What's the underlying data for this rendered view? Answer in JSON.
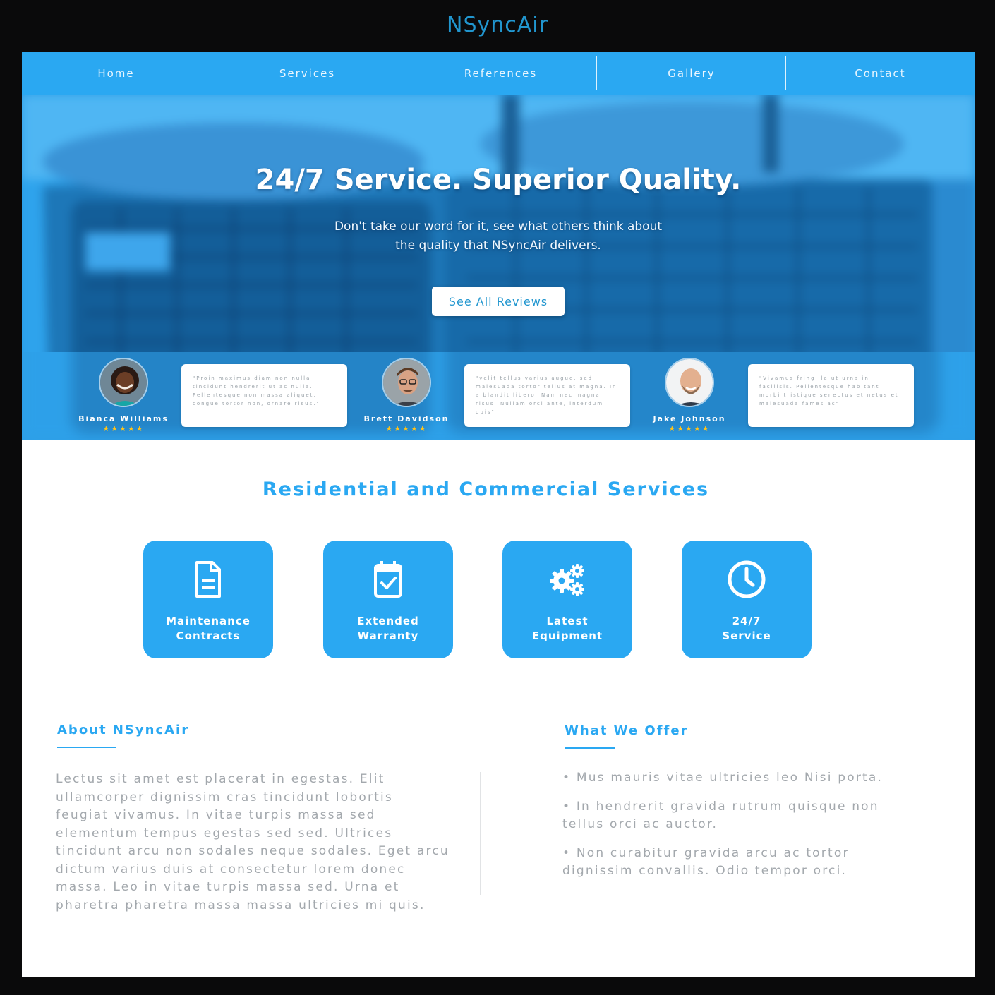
{
  "site": {
    "title": "NSyncAir"
  },
  "colors": {
    "accent": "#2aa8f2",
    "dark_bg": "#0a0a0b",
    "star": "#ffc21a",
    "body_text": "#a3a8ad"
  },
  "nav": {
    "items": [
      {
        "label": "Home"
      },
      {
        "label": "Services"
      },
      {
        "label": "References"
      },
      {
        "label": "Gallery"
      },
      {
        "label": "Contact"
      }
    ]
  },
  "hero": {
    "title": "24/7 Service. Superior Quality.",
    "subtitle": "Don't take our word for it, see what others think about the quality that NSyncAir delivers.",
    "button_label": "See All Reviews"
  },
  "reviews": [
    {
      "name": "Bianca Williams",
      "stars": "★★★★★",
      "rating": 5,
      "quote": "\"Proin maximus diam non nulla tincidunt hendrerit ut ac nulla. Pellentesque non massa aliquet, congue tortor non, ornare risus.\""
    },
    {
      "name": "Brett Davidson",
      "stars": "★★★★★",
      "rating": 5,
      "quote": "\"velit tellus varius augue, sed malesuada tortor tellus at magna. In a blandit libero. Nam nec magna risus. Nullam orci ante, interdum quis\""
    },
    {
      "name": "Jake Johnson",
      "stars": "★★★★★",
      "rating": 5,
      "quote": "\"Vivamus fringilla ut urna in facilisis. Pellentesque habitant morbi tristique senectus et netus et malesuada fames ac\""
    }
  ],
  "services": {
    "title": "Residential and Commercial Services",
    "cards": [
      {
        "line1": "Maintenance",
        "line2": "Contracts",
        "icon": "document-icon"
      },
      {
        "line1": "Extended",
        "line2": "Warranty",
        "icon": "calendar-check-icon"
      },
      {
        "line1": "Latest",
        "line2": "Equipment",
        "icon": "gears-icon"
      },
      {
        "line1": "24/7",
        "line2": "Service",
        "icon": "clock-icon"
      }
    ]
  },
  "about": {
    "heading": "About NSyncAir",
    "body": "Lectus sit amet est placerat in egestas. Elit ullamcorper dignissim cras tincidunt lobortis feugiat vivamus. In vitae turpis massa sed elementum tempus egestas sed sed. Ultrices tincidunt arcu non sodales neque sodales. Eget arcu dictum varius duis at consectetur lorem donec massa. Leo in vitae turpis massa sed. Urna et pharetra pharetra massa massa ultricies mi quis."
  },
  "offer": {
    "heading": "What We Offer",
    "items": [
      "• Mus mauris vitae ultricies leo Nisi porta.",
      "• In hendrerit gravida rutrum quisque non tellus orci ac auctor.",
      "• Non curabitur gravida arcu ac tortor dignissim convallis. Odio tempor orci."
    ]
  }
}
